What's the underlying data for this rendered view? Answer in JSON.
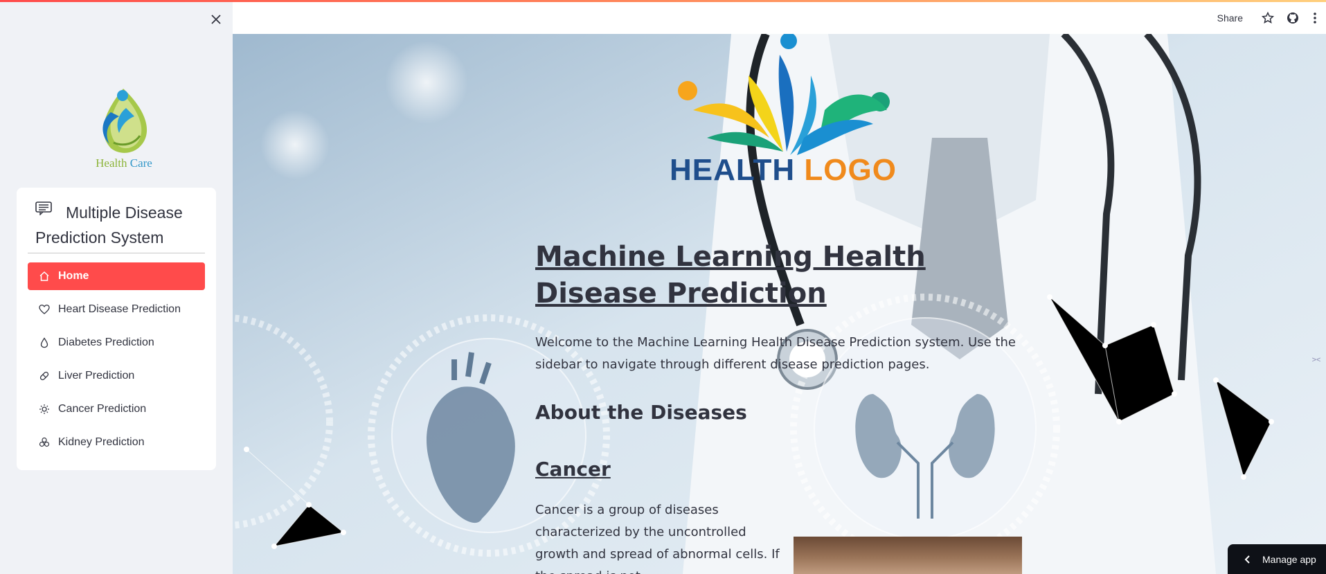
{
  "sidebar": {
    "logo": {
      "word1": "Health",
      "word2": "Care"
    },
    "menu_title": "Multiple Disease Prediction System",
    "items": [
      {
        "label": "Home",
        "icon": "house-icon",
        "active": true
      },
      {
        "label": "Heart Disease Prediction",
        "icon": "heart-icon",
        "active": false
      },
      {
        "label": "Diabetes Prediction",
        "icon": "droplet-icon",
        "active": false
      },
      {
        "label": "Liver Prediction",
        "icon": "pill-icon",
        "active": false
      },
      {
        "label": "Cancer Prediction",
        "icon": "sun-icon",
        "active": false
      },
      {
        "label": "Kidney Prediction",
        "icon": "cluster-icon",
        "active": false
      }
    ]
  },
  "header": {
    "share_label": "Share"
  },
  "main": {
    "logo": {
      "word1": "HEALTH",
      "word2": "LOGO"
    },
    "title": "Machine Learning Health Disease Prediction",
    "intro": "Welcome to the Machine Learning Health Disease Prediction system. Use the sidebar to navigate through different disease prediction pages.",
    "about_heading": "About the Diseases",
    "cancer_heading": "Cancer",
    "cancer_text": "Cancer is a group of diseases characterized by the uncontrolled growth and spread of abnormal cells. If the spread is not"
  },
  "manage_app": {
    "label": "Manage app"
  },
  "colors": {
    "accent": "#ff4b4b",
    "sidebar_bg": "#f0f2f6",
    "text": "#31333f"
  }
}
